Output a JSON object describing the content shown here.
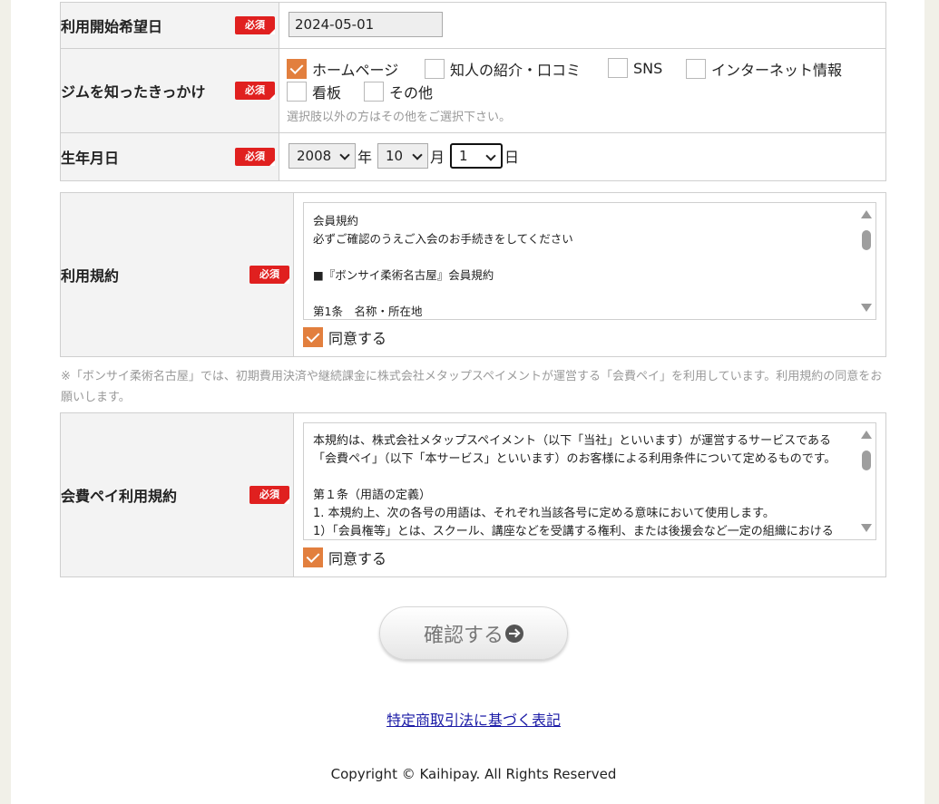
{
  "form": {
    "required_badge": "必須",
    "start_date": {
      "label": "利用開始希望日",
      "value": "2024-05-01"
    },
    "referral": {
      "label": "ジムを知ったきっかけ",
      "options": [
        {
          "label": "ホームページ",
          "checked": true
        },
        {
          "label": "知人の紹介・口コミ",
          "checked": false
        },
        {
          "label": "SNS",
          "checked": false
        },
        {
          "label": "インターネット情報",
          "checked": false
        },
        {
          "label": "看板",
          "checked": false
        },
        {
          "label": "その他",
          "checked": false
        }
      ],
      "hint": "選択肢以外の方はその他をご選択下さい。"
    },
    "birthdate": {
      "label": "生年月日",
      "year": "2008",
      "year_unit": "年",
      "month": "10",
      "month_unit": "月",
      "day": "1",
      "day_unit": "日"
    }
  },
  "terms": {
    "label": "利用規約",
    "lines": [
      "会員規約",
      "必ずご確認のうえご入会のお手続きをしてください",
      "",
      "■『ボンサイ柔術名古屋』会員規約",
      "",
      "第1条　名称・所在地"
    ],
    "agree_label": "同意する",
    "agreed": true
  },
  "note": "※「ボンサイ柔術名古屋」では、初期費用決済や継続課金に株式会社メタップスペイメントが運営する「会費ペイ」を利用しています。利用規約の同意をお願いします。",
  "pay_terms": {
    "label": "会費ペイ利用規約",
    "lines": [
      "本規約は、株式会社メタップスペイメント（以下「当社」といいます）が運営するサービスである",
      "「会費ペイ」（以下「本サービス」といいます）のお客様による利用条件について定めるものです。",
      "",
      "第１条（用語の定義）",
      "1. 本規約上、次の各号の用語は、それぞれ当該各号に定める意味において使用します。",
      "1）「会員権等」とは、スクール、講座などを受講する権利、または後援会など一定の組織における"
    ],
    "agree_label": "同意する",
    "agreed": true
  },
  "confirm_button": {
    "label": "確認する",
    "icon": "arrow-circle-right-icon"
  },
  "footer": {
    "law_link": "特定商取引法に基づく表記",
    "copyright": "Copyright © Kaihipay. All Rights Reserved"
  },
  "colors": {
    "required": "#e0201f",
    "checkbox_checked": "#e27f3e",
    "link": "#1a1aa6"
  }
}
